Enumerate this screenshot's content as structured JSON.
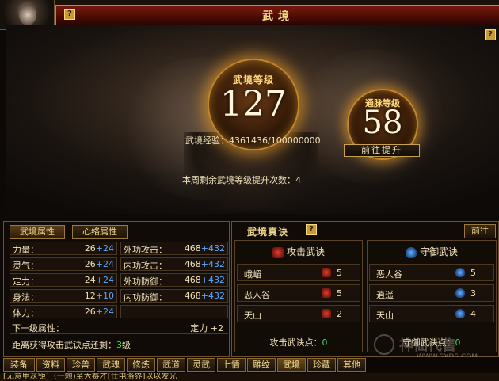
{
  "window": {
    "title": "武境",
    "help": "?"
  },
  "orb_main": {
    "label": "武境等级",
    "value": "127"
  },
  "orb_small": {
    "label": "通脉等级",
    "value": "58"
  },
  "experience": {
    "label": "武境经验：",
    "value": "4361436/100000000"
  },
  "go_upgrade": "前往提升",
  "weekly_text": "本周剩余武境等级提升次数：4",
  "left_tabs": [
    "武境属性",
    "心络属性"
  ],
  "stats": [
    {
      "k": "力量：",
      "base": "26",
      "bonus": "+24"
    },
    {
      "k": "外功攻击：",
      "base": "468",
      "bonus": "+432"
    },
    {
      "k": "灵气：",
      "base": "26",
      "bonus": "+24"
    },
    {
      "k": "内功攻击：",
      "base": "468",
      "bonus": "+432"
    },
    {
      "k": "定力：",
      "base": "24",
      "bonus": "+24"
    },
    {
      "k": "外功防御：",
      "base": "468",
      "bonus": "+432"
    },
    {
      "k": "身法：",
      "base": "12",
      "bonus": "+10"
    },
    {
      "k": "内功防御：",
      "base": "468",
      "bonus": "+432"
    },
    {
      "k": "体力：",
      "base": "26",
      "bonus": "+24"
    }
  ],
  "next_level": {
    "label": "下一级属性：",
    "value": "定力 +2"
  },
  "distance": {
    "prefix": "距离获得攻击武诀点还剩：",
    "num": "3",
    "suffix": "级"
  },
  "right_panel": {
    "title": "武境真诀",
    "go": "前往"
  },
  "attack": {
    "title": "攻击武诀",
    "rows": [
      {
        "name": "峨嵋",
        "count": "5"
      },
      {
        "name": "恶人谷",
        "count": "5"
      },
      {
        "name": "天山",
        "count": "2"
      }
    ],
    "points_label": "攻击武诀点：",
    "points": "0"
  },
  "defense": {
    "title": "守御武诀",
    "rows": [
      {
        "name": "恶人谷",
        "count": "5"
      },
      {
        "name": "逍遥",
        "count": "3"
      },
      {
        "name": "天山",
        "count": "4"
      }
    ],
    "points_label": "守御武诀点：",
    "points": "0"
  },
  "bottom_tabs": [
    "装备",
    "资料",
    "珍兽",
    "武魂",
    "修炼",
    "武道",
    "灵武",
    "七情",
    "雕纹",
    "武境",
    "珍藏",
    "其他"
  ],
  "active_tab": "武境",
  "chat_line": "[无意甲灰钜]（一颗)至大赛才[仕电洛界]以以发光",
  "watermark": {
    "text": "神仙代售",
    "url": "WWW.SXDS.COM"
  }
}
